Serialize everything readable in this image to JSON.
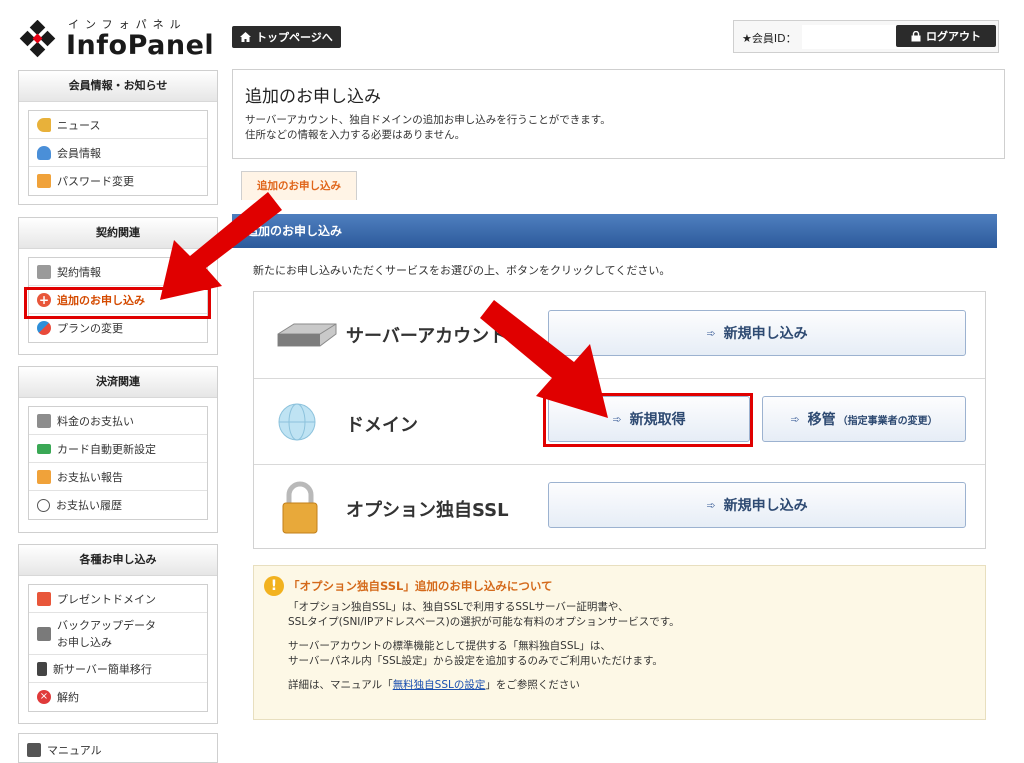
{
  "header": {
    "logo_kana": "インフォパネル",
    "logo_name": "InfoPanel",
    "top_link": "トップページへ",
    "member_label": "★会員ID：",
    "member_id": "",
    "logout": "ログアウト"
  },
  "sidebar": {
    "member": {
      "heading": "会員情報・お知らせ",
      "items": [
        {
          "label": "ニュース",
          "icon": "key-icon"
        },
        {
          "label": "会員情報",
          "icon": "person-icon"
        },
        {
          "label": "パスワード変更",
          "icon": "lock-icon"
        }
      ]
    },
    "contract": {
      "heading": "契約関連",
      "items": [
        {
          "label": "契約情報",
          "icon": "pen-icon"
        },
        {
          "label": "追加のお申し込み",
          "icon": "plus-circle-icon"
        },
        {
          "label": "プランの変更",
          "icon": "refresh-icon"
        }
      ]
    },
    "payment": {
      "heading": "決済関連",
      "items": [
        {
          "label": "料金のお支払い",
          "icon": "calculator-icon"
        },
        {
          "label": "カード自動更新設定",
          "icon": "card-icon"
        },
        {
          "label": "お支払い報告",
          "icon": "chat-icon"
        },
        {
          "label": "お支払い履歴",
          "icon": "clock-icon"
        }
      ]
    },
    "applications": {
      "heading": "各種お申し込み",
      "items": [
        {
          "label": "プレゼントドメイン",
          "icon": "gift-icon"
        },
        {
          "label": "バックアップデータ",
          "label2": "お申し込み",
          "icon": "backup-icon"
        },
        {
          "label": "新サーバー簡単移行",
          "icon": "server-icon"
        },
        {
          "label": "解約",
          "icon": "cancel-icon"
        }
      ]
    },
    "manual": {
      "label": "マニュアル",
      "icon": "book-icon"
    }
  },
  "main": {
    "title": "追加のお申し込み",
    "desc1": "サーバーアカウント、独自ドメインの追加お申し込みを行うことができます。",
    "desc2": "住所などの情報を入力する必要はありません。",
    "tab": "追加のお申し込み",
    "section_title": "追加のお申し込み",
    "instruction": "新たにお申し込みいただくサービスをお選びの上、ボタンをクリックしてください。",
    "services": {
      "server": {
        "name": "サーバーアカウント",
        "button": "新規申し込み",
        "icon": "server-icon"
      },
      "domain": {
        "name": "ドメイン",
        "button1": "新規取得",
        "button2": "移管",
        "button2_note": "（指定事業者の変更）",
        "icon": "globe-icon"
      },
      "ssl": {
        "name": "オプション独自SSL",
        "button": "新規申し込み",
        "icon": "padlock-icon"
      }
    },
    "notice": {
      "title": "「オプション独自SSL」追加のお申し込みについて",
      "p1a": "「オプション独自SSL」は、独自SSLで利用するSSLサーバー証明書や、",
      "p1b": "SSLタイプ(SNI/IPアドレスベース)の選択が可能な有料のオプションサービスです。",
      "p2a": "サーバーアカウントの標準機能として提供する「無料独自SSL」は、",
      "p2b": "サーバーパネル内「SSL設定」から設定を追加するのみでご利用いただけます。",
      "p3_before": "詳細は、マニュアル「",
      "p3_link": "無料独自SSLの設定",
      "p3_after": "」をご参照ください"
    }
  },
  "colors": {
    "annotation_red": "#e00000",
    "accent_orange": "#e0651a",
    "section_blue": "#2c5a9b"
  }
}
